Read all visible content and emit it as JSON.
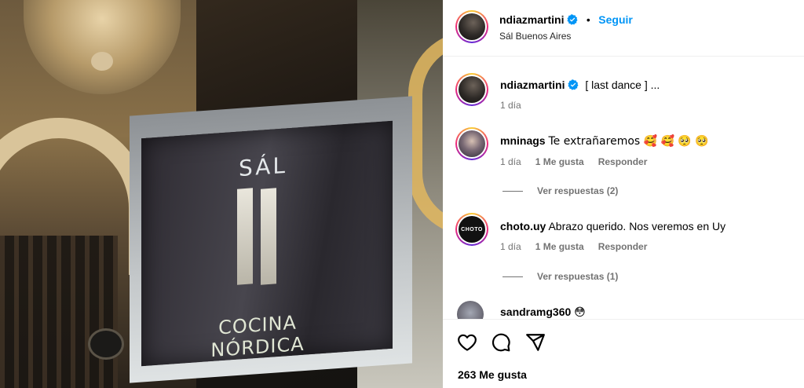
{
  "photo": {
    "sign_title": "SÁL",
    "sign_subtitle": "COCINA NÓRDICA"
  },
  "header": {
    "username": "ndiazmartini",
    "separator": "•",
    "follow_label": "Seguir",
    "location": "Sál Buenos Aires"
  },
  "caption": {
    "username": "ndiazmartini",
    "text": "[ last dance ] ...",
    "time": "1 día"
  },
  "comments": [
    {
      "username": "mninags",
      "text": "Te extrañaremos 🥰 🥰 🥺 🥺",
      "time": "1 día",
      "likes": "1 Me gusta",
      "reply_label": "Responder",
      "view_replies": "Ver respuestas (2)"
    },
    {
      "username": "choto.uy",
      "avatar_text": "CHOTO",
      "text": "Abrazo querido. Nos veremos en Uy",
      "time": "1 día",
      "likes": "1 Me gusta",
      "reply_label": "Responder",
      "view_replies": "Ver respuestas (1)"
    },
    {
      "username": "sandramg360",
      "text": "😳"
    }
  ],
  "footer": {
    "likes": "263 Me gusta"
  },
  "icons": {
    "like": "heart-icon",
    "comment": "comment-icon",
    "share": "share-icon",
    "verified": "verified-badge-icon"
  },
  "colors": {
    "accent": "#0095f6",
    "secondary_text": "#737373",
    "verified": "#0095f6"
  }
}
